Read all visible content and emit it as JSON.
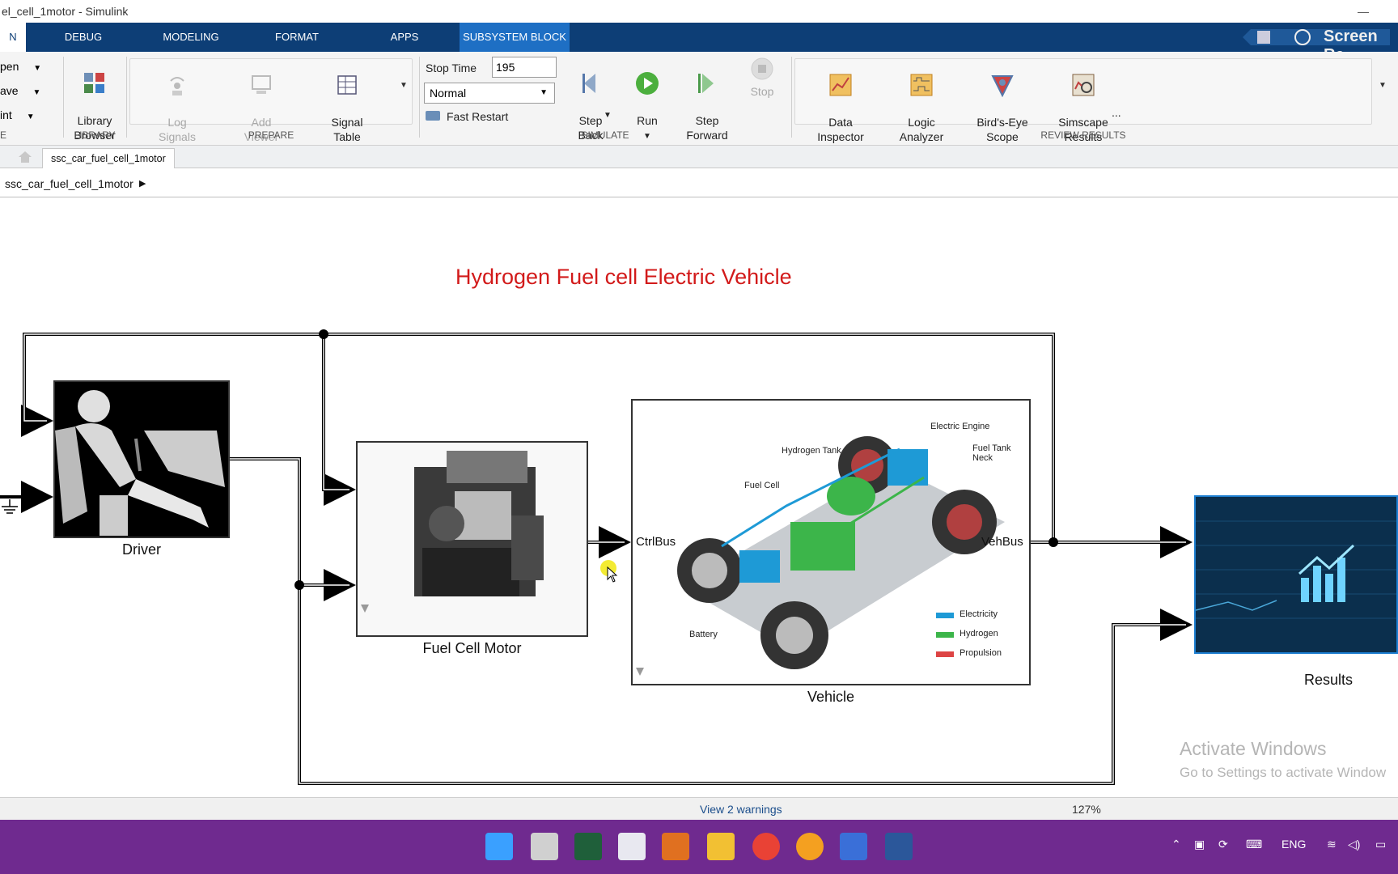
{
  "window": {
    "title": "el_cell_1motor - Simulink"
  },
  "tabs": [
    {
      "label": "N"
    },
    {
      "label": "DEBUG"
    },
    {
      "label": "MODELING"
    },
    {
      "label": "FORMAT"
    },
    {
      "label": "APPS"
    },
    {
      "label": "SUBSYSTEM BLOCK"
    }
  ],
  "recorder": {
    "label": "Screen Re"
  },
  "file_group": {
    "open": "pen",
    "save": "ave",
    "print": "int",
    "label": "E"
  },
  "library": {
    "button": "Library\nBrowser",
    "label": "LIBRARY"
  },
  "prepare": {
    "log_signals": "Log\nSignals",
    "add_viewer": "Add\nViewer",
    "signal_table": "Signal\nTable",
    "label": "PREPARE"
  },
  "simulate": {
    "stop_time_label": "Stop Time",
    "stop_time_value": "195",
    "mode": "Normal",
    "fast_restart": "Fast Restart",
    "step_back": "Step\nBack",
    "run": "Run",
    "step_forward": "Step\nForward",
    "stop": "Stop",
    "label": "SIMULATE"
  },
  "review": {
    "data_inspector": "Data\nInspector",
    "logic_analyzer": "Logic\nAnalyzer",
    "birds_eye": "Bird's-Eye\nScope",
    "simscape": "Simscape\nResults",
    "label": "REVIEW RESULTS"
  },
  "model_tab": "ssc_car_fuel_cell_1motor",
  "breadcrumb": "ssc_car_fuel_cell_1motor",
  "canvas": {
    "title": "Hydrogen Fuel cell Electric Vehicle",
    "blocks": {
      "driver": "Driver",
      "fuel_cell_motor": "Fuel Cell Motor",
      "vehicle": "Vehicle",
      "results": "Results"
    },
    "ports": {
      "ctrl_bus": "CtrlBus",
      "veh_bus": "VehBus"
    },
    "vehicle_image": {
      "electric_engine": "Electric Engine",
      "hydrogen_tank": "Hydrogen Tank",
      "fuel_tank_neck": "Fuel Tank Neck",
      "fuel_cell": "Fuel Cell",
      "battery": "Battery",
      "legend_electricity": "Electricity",
      "legend_hydrogen": "Hydrogen",
      "legend_propulsion": "Propulsion"
    },
    "watermark": {
      "line1": "Activate Windows",
      "line2": "Go to Settings to activate Window"
    }
  },
  "status": {
    "warnings": "View 2 warnings",
    "zoom": "127%"
  },
  "taskbar": {
    "lang": "ENG"
  }
}
